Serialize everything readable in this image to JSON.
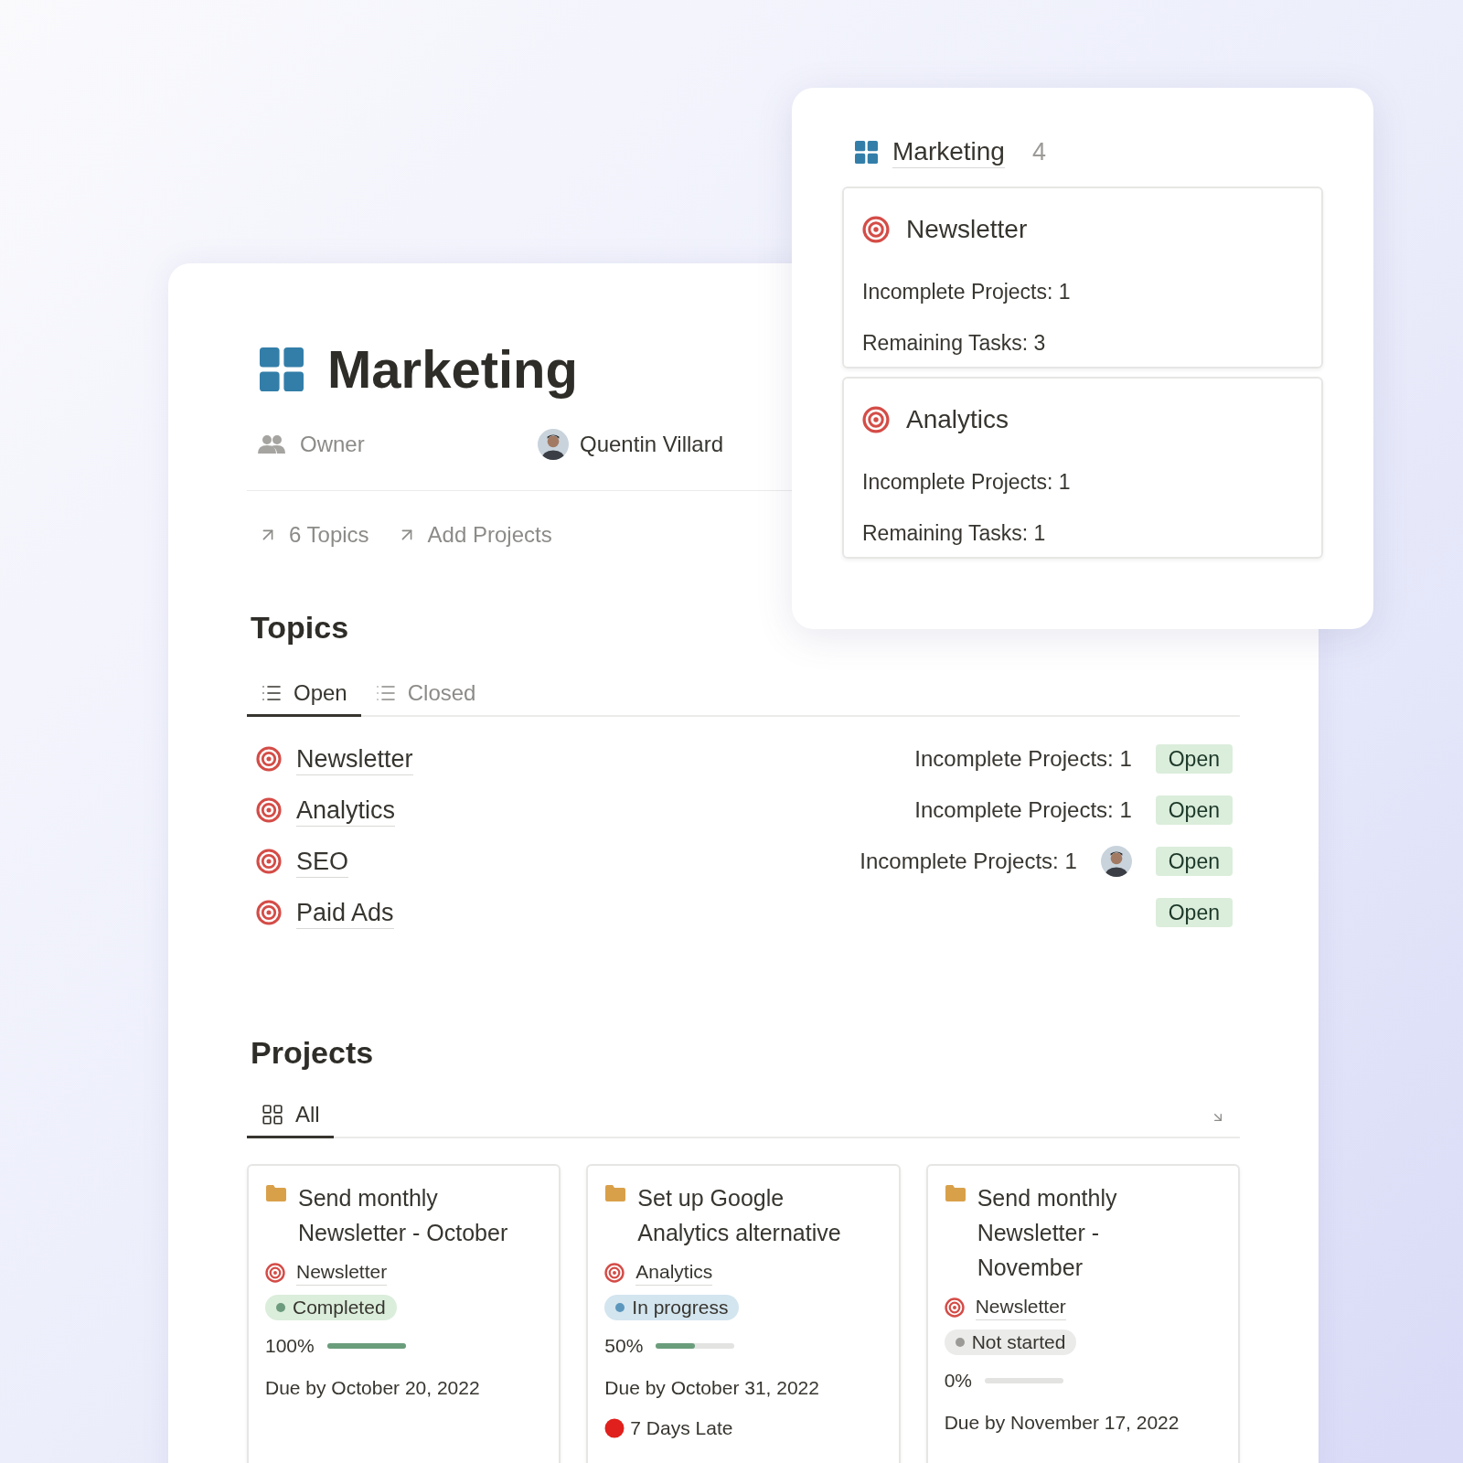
{
  "page": {
    "title": "Marketing",
    "owner_label": "Owner",
    "owner_name": "Quentin Villard",
    "links": [
      "6 Topics",
      "Add Projects"
    ]
  },
  "topics": {
    "heading": "Topics",
    "tabs": [
      {
        "label": "Open",
        "selected": true
      },
      {
        "label": "Closed",
        "selected": false
      }
    ],
    "rows": [
      {
        "name": "Newsletter",
        "summary": "Incomplete Projects: 1",
        "assigned": false,
        "status": "Open"
      },
      {
        "name": "Analytics",
        "summary": "Incomplete Projects: 1",
        "assigned": false,
        "status": "Open"
      },
      {
        "name": "SEO",
        "summary": "Incomplete Projects: 1",
        "assigned": true,
        "status": "Open"
      },
      {
        "name": "Paid Ads",
        "assigned": false,
        "status": "Open"
      }
    ]
  },
  "projects": {
    "heading": "Projects",
    "tabs": [
      {
        "label": "All",
        "selected": true
      }
    ],
    "cards": [
      {
        "title": "Send monthly Newsletter - October",
        "topic": "Newsletter",
        "status": {
          "label": "Completed",
          "kind": "completed"
        },
        "progress": "100%",
        "level": 1,
        "due": "Due by October 20, 2022"
      },
      {
        "title": "Set up Google Analytics alternative",
        "topic": "Analytics",
        "status": {
          "label": "In progress",
          "kind": "in_progress"
        },
        "progress": "50%",
        "level": 0.5,
        "due": "Due by October 31, 2022",
        "late": "7 Days Late"
      },
      {
        "title": "Send monthly Newsletter - November",
        "topic": "Newsletter",
        "status": {
          "label": "Not started",
          "kind": "not_started"
        },
        "progress": "0%",
        "level": 0,
        "due": "Due by November 17, 2022"
      }
    ]
  },
  "popup": {
    "title": "Marketing",
    "count": "4",
    "cards": [
      {
        "title": "Newsletter",
        "lines": [
          "Incomplete Projects: 1",
          "Remaining Tasks: 3"
        ]
      },
      {
        "title": "Analytics",
        "lines": [
          "Incomplete Projects: 1",
          "Remaining Tasks: 1"
        ]
      }
    ]
  }
}
